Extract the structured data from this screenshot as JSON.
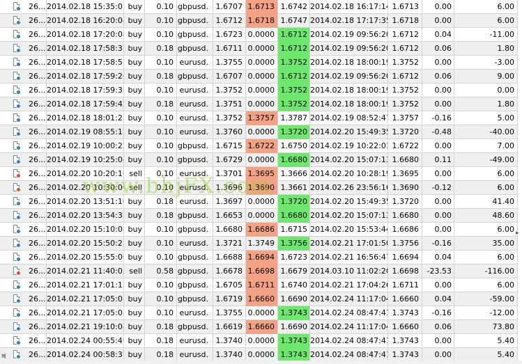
{
  "watermark": "www.bhjFX.com",
  "edge_mark": "폐",
  "scroll_arrow": "▸",
  "colors": {
    "loss_cell": "#f4a284",
    "profit_cell": "#6ce86c",
    "buy_dot": "#2a7fd4",
    "sell_dot": "#e0501e"
  },
  "columns": [
    "order",
    "open_time",
    "type",
    "size",
    "symbol",
    "price",
    "sl",
    "tp",
    "close_time",
    "close_price",
    "swap",
    "profit"
  ],
  "rows": [
    {
      "order": "26...",
      "open_time": "2014.02.18 15:35:01",
      "type": "buy",
      "size": "0.10",
      "symbol": "gbpusd.",
      "price": "1.6707",
      "sl": "1.6713",
      "tp": "1.6742",
      "close_time": "2014.02.18 16:17:14",
      "close_price": "1.6713",
      "swap": "0.00",
      "profit": "6.00",
      "hl": "sl"
    },
    {
      "order": "26...",
      "open_time": "2014.02.18 16:20:04",
      "type": "buy",
      "size": "0.10",
      "symbol": "gbpusd.",
      "price": "1.6712",
      "sl": "1.6718",
      "tp": "1.6747",
      "close_time": "2014.02.18 17:17:35",
      "close_price": "1.6718",
      "swap": "0.00",
      "profit": "6.00",
      "hl": "sl"
    },
    {
      "order": "26...",
      "open_time": "2014.02.18 17:20:08",
      "type": "buy",
      "size": "0.10",
      "symbol": "gbpusd.",
      "price": "1.6723",
      "sl": "0.0000",
      "tp": "1.6712",
      "close_time": "2014.02.19 09:56:20",
      "close_price": "1.6712",
      "swap": "0.04",
      "profit": "-11.00",
      "hl": "tp"
    },
    {
      "order": "26...",
      "open_time": "2014.02.18 17:58:37",
      "type": "buy",
      "size": "0.18",
      "symbol": "gbpusd.",
      "price": "1.6711",
      "sl": "0.0000",
      "tp": "1.6712",
      "close_time": "2014.02.19 09:56:20",
      "close_price": "1.6712",
      "swap": "0.06",
      "profit": "1.80",
      "hl": "tp"
    },
    {
      "order": "26...",
      "open_time": "2014.02.18 17:58:57",
      "type": "buy",
      "size": "0.10",
      "symbol": "eurusd.",
      "price": "1.3755",
      "sl": "0.0000",
      "tp": "1.3752",
      "close_time": "2014.02.18 18:00:19",
      "close_price": "1.3752",
      "swap": "0.00",
      "profit": "-3.00",
      "hl": "tp"
    },
    {
      "order": "26...",
      "open_time": "2014.02.18 17:59:26",
      "type": "buy",
      "size": "0.18",
      "symbol": "gbpusd.",
      "price": "1.6707",
      "sl": "0.0000",
      "tp": "1.6712",
      "close_time": "2014.02.19 09:56:20",
      "close_price": "1.6712",
      "swap": "0.06",
      "profit": "9.00",
      "hl": "tp"
    },
    {
      "order": "26...",
      "open_time": "2014.02.18 17:59:38",
      "type": "buy",
      "size": "0.10",
      "symbol": "eurusd.",
      "price": "1.3752",
      "sl": "0.0000",
      "tp": "1.3752",
      "close_time": "2014.02.18 18:00:19",
      "close_price": "1.3752",
      "swap": "0.00",
      "profit": "0.00",
      "hl": "tp"
    },
    {
      "order": "26...",
      "open_time": "2014.02.18 17:59:42",
      "type": "buy",
      "size": "0.18",
      "symbol": "eurusd.",
      "price": "1.3751",
      "sl": "0.0000",
      "tp": "1.3752",
      "close_time": "2014.02.18 18:00:19",
      "close_price": "1.3752",
      "swap": "0.00",
      "profit": "1.80",
      "hl": "tp"
    },
    {
      "order": "26...",
      "open_time": "2014.02.18 18:01:25",
      "type": "buy",
      "size": "0.10",
      "symbol": "eurusd.",
      "price": "1.3752",
      "sl": "1.3757",
      "tp": "1.3787",
      "close_time": "2014.02.19 08:52:47",
      "close_price": "1.3757",
      "swap": "-0.16",
      "profit": "5.00",
      "hl": "sl"
    },
    {
      "order": "26...",
      "open_time": "2014.02.19 08:55:17",
      "type": "buy",
      "size": "0.10",
      "symbol": "eurusd.",
      "price": "1.3760",
      "sl": "0.0000",
      "tp": "1.3720",
      "close_time": "2014.02.20 15:49:35",
      "close_price": "1.3720",
      "swap": "-0.48",
      "profit": "-40.00",
      "hl": "tp"
    },
    {
      "order": "26...",
      "open_time": "2014.02.19 10:00:22",
      "type": "buy",
      "size": "0.10",
      "symbol": "gbpusd.",
      "price": "1.6715",
      "sl": "1.6722",
      "tp": "1.6750",
      "close_time": "2014.02.19 10:22:01",
      "close_price": "1.6722",
      "swap": "0.00",
      "profit": "7.00",
      "hl": "sl"
    },
    {
      "order": "26...",
      "open_time": "2014.02.19 10:25:04",
      "type": "buy",
      "size": "0.10",
      "symbol": "gbpusd.",
      "price": "1.6729",
      "sl": "0.0000",
      "tp": "1.6680",
      "close_time": "2014.02.20 15:07:13",
      "close_price": "1.6680",
      "swap": "0.11",
      "profit": "-49.00",
      "hl": "tp"
    },
    {
      "order": "26...",
      "open_time": "2014.02.20 10:20:16",
      "type": "sell",
      "size": "0.10",
      "symbol": "eurusd.",
      "price": "1.3701",
      "sl": "1.3695",
      "tp": "1.3666",
      "close_time": "2014.02.20 10:28:19",
      "close_price": "1.3695",
      "swap": "0.00",
      "profit": "6.00",
      "hl": "sl"
    },
    {
      "order": "26...",
      "open_time": "2014.02.20 10:30:06",
      "type": "sell",
      "size": "0.10",
      "symbol": "eurusd.",
      "price": "1.3696",
      "sl": "1.3690",
      "tp": "1.3661",
      "close_time": "2014.02.26 23:56:16",
      "close_price": "1.3690",
      "swap": "-0.12",
      "profit": "6.00",
      "hl": "sl"
    },
    {
      "order": "26...",
      "open_time": "2014.02.20 13:51:10",
      "type": "buy",
      "size": "0.18",
      "symbol": "eurusd.",
      "price": "1.3697",
      "sl": "0.0000",
      "tp": "1.3720",
      "close_time": "2014.02.20 15:49:35",
      "close_price": "1.3720",
      "swap": "0.00",
      "profit": "41.40",
      "hl": "tp"
    },
    {
      "order": "26...",
      "open_time": "2014.02.20 13:54:33",
      "type": "buy",
      "size": "0.18",
      "symbol": "gbpusd.",
      "price": "1.6653",
      "sl": "0.0000",
      "tp": "1.6680",
      "close_time": "2014.02.20 15:07:13",
      "close_price": "1.6680",
      "swap": "0.00",
      "profit": "48.60",
      "hl": "tp"
    },
    {
      "order": "26...",
      "open_time": "2014.02.20 15:10:08",
      "type": "buy",
      "size": "0.10",
      "symbol": "gbpusd.",
      "price": "1.6680",
      "sl": "1.6686",
      "tp": "1.6715",
      "close_time": "2014.02.20 15:53:44",
      "close_price": "1.6686",
      "swap": "0.00",
      "profit": "6.00",
      "hl": "sl"
    },
    {
      "order": "26...",
      "open_time": "2014.02.20 15:50:21",
      "type": "buy",
      "size": "0.10",
      "symbol": "eurusd.",
      "price": "1.3721",
      "sl": "1.3749",
      "tp": "1.3756",
      "close_time": "2014.02.21 17:01:50",
      "close_price": "1.3756",
      "swap": "-0.16",
      "profit": "35.00",
      "hl": "tp"
    },
    {
      "order": "26...",
      "open_time": "2014.02.20 15:55:06",
      "type": "buy",
      "size": "0.10",
      "symbol": "gbpusd.",
      "price": "1.6688",
      "sl": "1.6694",
      "tp": "1.6723",
      "close_time": "2014.02.21 16:56:47",
      "close_price": "1.6694",
      "swap": "0.04",
      "profit": "6.00",
      "hl": "sl"
    },
    {
      "order": "26...",
      "open_time": "2014.02.21 11:40:05",
      "type": "sell",
      "size": "0.58",
      "symbol": "gbpusd.",
      "price": "1.6678",
      "sl": "1.6698",
      "tp": "1.6679",
      "close_time": "2014.03.10 11:02:20",
      "close_price": "1.6698",
      "swap": "-23.53",
      "profit": "-116.00",
      "hl": "sl"
    },
    {
      "order": "26...",
      "open_time": "2014.02.21 17:01:15",
      "type": "buy",
      "size": "0.10",
      "symbol": "gbpusd.",
      "price": "1.6705",
      "sl": "1.6711",
      "tp": "1.6740",
      "close_time": "2014.02.21 17:04:26",
      "close_price": "1.6711",
      "swap": "0.00",
      "profit": "6.00",
      "hl": "sl"
    },
    {
      "order": "26...",
      "open_time": "2014.02.21 17:05:03",
      "type": "buy",
      "size": "0.10",
      "symbol": "gbpusd.",
      "price": "1.6719",
      "sl": "1.6660",
      "tp": "1.6690",
      "close_time": "2014.02.24 11:17:04",
      "close_price": "1.6660",
      "swap": "0.04",
      "profit": "-59.00",
      "hl": "sl"
    },
    {
      "order": "26...",
      "open_time": "2014.02.21 17:05:05",
      "type": "buy",
      "size": "0.10",
      "symbol": "eurusd.",
      "price": "1.3755",
      "sl": "0.0000",
      "tp": "1.3743",
      "close_time": "2014.02.24 08:47:41",
      "close_price": "1.3743",
      "swap": "-0.16",
      "profit": "-12.00",
      "hl": "tp"
    },
    {
      "order": "26...",
      "open_time": "2014.02.21 19:10:04",
      "type": "buy",
      "size": "0.18",
      "symbol": "gbpusd.",
      "price": "1.6619",
      "sl": "1.6660",
      "tp": "1.6690",
      "close_time": "2014.02.24 11:17:04",
      "close_price": "1.6660",
      "swap": "0.06",
      "profit": "73.80",
      "hl": "sl"
    },
    {
      "order": "26...",
      "open_time": "2014.02.24 00:55:49",
      "type": "buy",
      "size": "0.18",
      "symbol": "eurusd.",
      "price": "1.3740",
      "sl": "0.0000",
      "tp": "1.3743",
      "close_time": "2014.02.24 08:47:41",
      "close_price": "1.3743",
      "swap": "0.00",
      "profit": "5.40",
      "hl": "tp"
    },
    {
      "order": "26...",
      "open_time": "2014.02.24 00:58:37",
      "type": "buy",
      "size": "0.18",
      "symbol": "eurusd.",
      "price": "1.3740",
      "sl": "0.0000",
      "tp": "1.3743",
      "close_time": "2014.02.24 08:47:41",
      "close_price": "1.3743",
      "swap": "0.00",
      "profit": "5.40",
      "hl": "tp"
    }
  ]
}
